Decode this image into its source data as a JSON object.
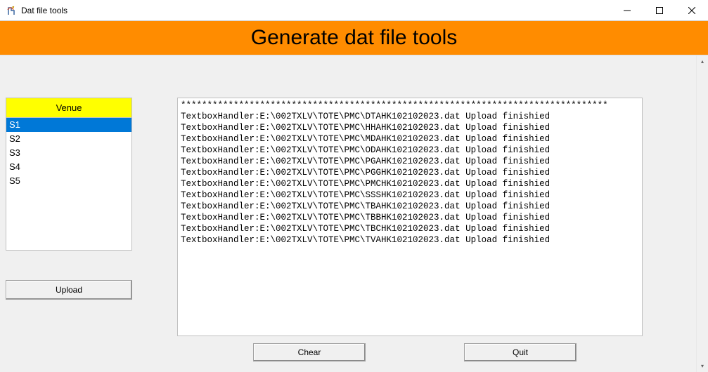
{
  "window": {
    "title": "Dat file tools"
  },
  "banner": {
    "title": "Generate dat file tools"
  },
  "venue": {
    "header": "Venue",
    "items": [
      "S1",
      "S2",
      "S3",
      "S4",
      "S5"
    ],
    "selected_index": 0
  },
  "buttons": {
    "upload": "Upload",
    "chear": "Chear",
    "quit": "Quit"
  },
  "log": {
    "separator": "*********************************************************************************",
    "lines": [
      "TextboxHandler:E:\\002TXLV\\TOTE\\PMC\\DTAHK102102023.dat Upload finishied",
      "TextboxHandler:E:\\002TXLV\\TOTE\\PMC\\HHAHK102102023.dat Upload finishied",
      "TextboxHandler:E:\\002TXLV\\TOTE\\PMC\\MDAHK102102023.dat Upload finishied",
      "TextboxHandler:E:\\002TXLV\\TOTE\\PMC\\ODAHK102102023.dat Upload finishied",
      "TextboxHandler:E:\\002TXLV\\TOTE\\PMC\\PGAHK102102023.dat Upload finishied",
      "TextboxHandler:E:\\002TXLV\\TOTE\\PMC\\PGGHK102102023.dat Upload finishied",
      "TextboxHandler:E:\\002TXLV\\TOTE\\PMC\\PMCHK102102023.dat Upload finishied",
      "TextboxHandler:E:\\002TXLV\\TOTE\\PMC\\SSSHK102102023.dat Upload finishied",
      "TextboxHandler:E:\\002TXLV\\TOTE\\PMC\\TBAHK102102023.dat Upload finishied",
      "TextboxHandler:E:\\002TXLV\\TOTE\\PMC\\TBBHK102102023.dat Upload finishied",
      "TextboxHandler:E:\\002TXLV\\TOTE\\PMC\\TBCHK102102023.dat Upload finishied",
      "TextboxHandler:E:\\002TXLV\\TOTE\\PMC\\TVAHK102102023.dat Upload finishied"
    ]
  }
}
